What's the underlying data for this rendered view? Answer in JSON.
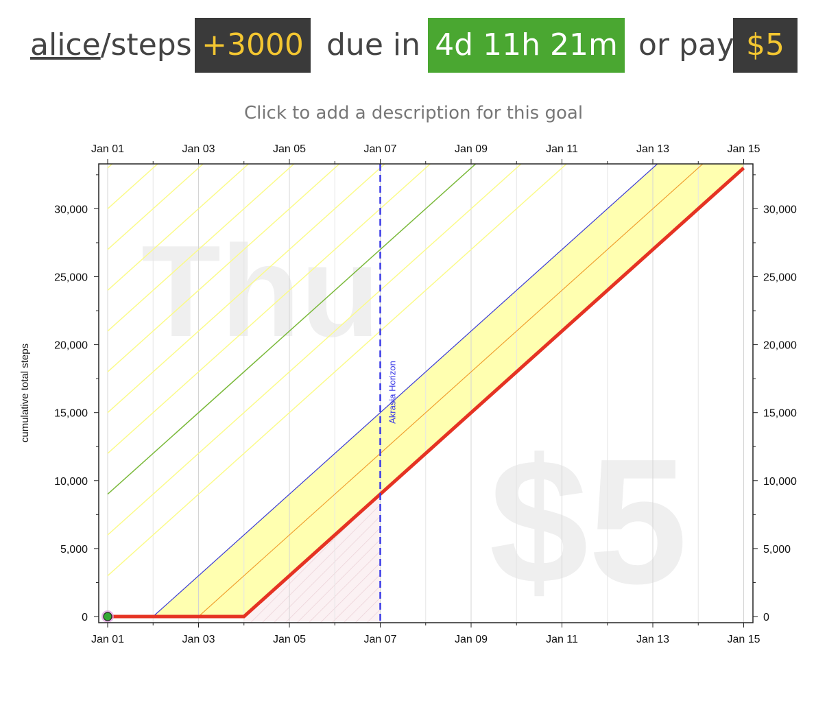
{
  "header": {
    "user": "alice",
    "goal_suffix": "/steps:",
    "delta": "+3000",
    "due_label": "due in",
    "countdown": "4d 11h 21m",
    "pay_label": "or pay",
    "pledge": "$5"
  },
  "description_prompt": "Click to add a description for this goal",
  "watermarks": {
    "day": "Thu",
    "pledge": "$5"
  },
  "colors": {
    "bright_red_line": "#e53323",
    "yellow_band": "#ffffb0",
    "blue_line": "#3b3bd6",
    "green_line": "#7ab93a",
    "orange_line": "#f0a030",
    "horizon": "#3a3ae6",
    "countdown_bg": "#4aa731",
    "badge_bg": "#3a3a3a",
    "badge_text": "#f3c631"
  },
  "chart_data": {
    "type": "line",
    "ylabel": "cumulative total steps",
    "x_ticks": [
      "Jan 01",
      "Jan 03",
      "Jan 05",
      "Jan 07",
      "Jan 09",
      "Jan 11",
      "Jan 13",
      "Jan 15"
    ],
    "y_ticks": [
      0,
      5000,
      10000,
      15000,
      20000,
      25000,
      30000
    ],
    "y_tick_labels": [
      "0",
      "5,000",
      "10,000",
      "15,000",
      "20,000",
      "25,000",
      "30,000"
    ],
    "xlim": [
      "Jan 01",
      "Jan 15"
    ],
    "ylim": [
      0,
      33000
    ],
    "grid": true,
    "horizon": {
      "date": "Jan 07",
      "label": "Akrasia Horizon"
    },
    "datapoints": [
      {
        "x": "Jan 01",
        "y": 0
      }
    ],
    "series": [
      {
        "color": "red",
        "points": [
          [
            "Jan 01",
            0
          ],
          [
            "Jan 04",
            0
          ],
          [
            "Jan 15",
            33000
          ]
        ]
      },
      {
        "color": "orange",
        "points": [
          [
            "Jan 01",
            0
          ],
          [
            "Jan 03",
            0
          ],
          [
            "Jan 15",
            36000
          ]
        ]
      },
      {
        "color": "blue",
        "points": [
          [
            "Jan 01",
            0
          ],
          [
            "Jan 02",
            0
          ],
          [
            "Jan 15",
            39000
          ]
        ]
      },
      {
        "color": "green",
        "points": [
          [
            "Jan 01",
            9000
          ],
          [
            "Jan 15",
            51000
          ]
        ]
      }
    ]
  }
}
